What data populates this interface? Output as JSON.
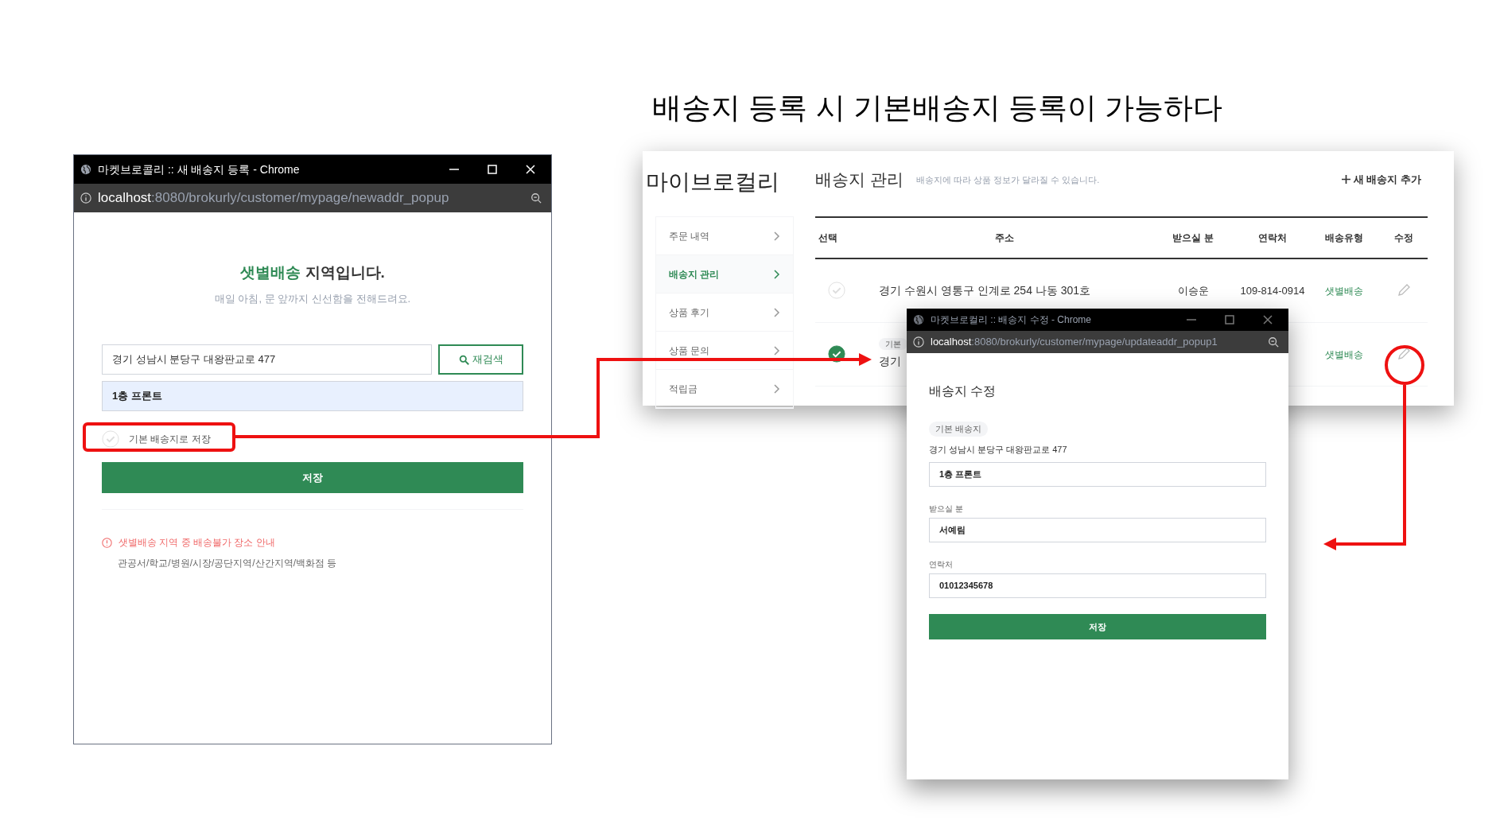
{
  "slide_title": "배송지 등록 시 기본배송지 등록이 가능하다",
  "new_address_popup": {
    "window_title": "마켓브로콜리 :: 새 배송지 등록 - Chrome",
    "url_host": "localhost",
    "url_path": ":8080/brokurly/customer/mypage/newaddr_popup",
    "headline_accent": "샛별배송",
    "headline_rest": "지역입니다.",
    "subtitle": "매일 아침, 문 앞까지 신선함을 전해드려요.",
    "address": "경기 성남시 분당구 대왕판교로 477",
    "research_button": "재검색",
    "detail": "1층 프론트",
    "default_checkbox": {
      "label": "기본 배송지로 저장",
      "checked": false
    },
    "save_button": "저장",
    "notice_title": "샛별배송 지역 중 배송불가 장소 안내",
    "notice_text": "관공서/학교/병원/시장/공단지역/산간지역/백화점 등"
  },
  "mypage": {
    "brand": "마이브로컬리",
    "sidebar": [
      {
        "label": "주문 내역",
        "selected": false
      },
      {
        "label": "배송지 관리",
        "selected": true
      },
      {
        "label": "상품 후기",
        "selected": false
      },
      {
        "label": "상품 문의",
        "selected": false
      },
      {
        "label": "적립금",
        "selected": false
      }
    ],
    "heading": "배송지 관리",
    "heading_note": "배송지에 따라 상품 정보가 달라질 수 있습니다.",
    "add_button": "새 배송지 추가",
    "columns": [
      "선택",
      "주소",
      "받으실 분",
      "연락처",
      "배송유형",
      "수정"
    ],
    "rows": [
      {
        "selected": false,
        "address": "경기 수원시 영통구 인계로 254 나동 301호",
        "recipient": "이승운",
        "phone": "109-814-0914",
        "type": "샛별배송"
      },
      {
        "selected": true,
        "badge": "기본",
        "address": "경기",
        "type": "샛별배송"
      }
    ]
  },
  "edit_popup": {
    "window_title": "마켓브로컬리 :: 배송지 수정 - Chrome",
    "url_host": "localhost",
    "url_path": ":8080/brokurly/customer/mypage/updateaddr_popup1",
    "heading": "배송지 수정",
    "badge": "기본 배송지",
    "address": "경기 성남시 분당구 대왕판교로 477",
    "detail": "1층 프론트",
    "fields": [
      {
        "label": "받으실 분",
        "value": "서예림"
      },
      {
        "label": "연락처",
        "value": "01012345678"
      }
    ],
    "save_button": "저장"
  }
}
